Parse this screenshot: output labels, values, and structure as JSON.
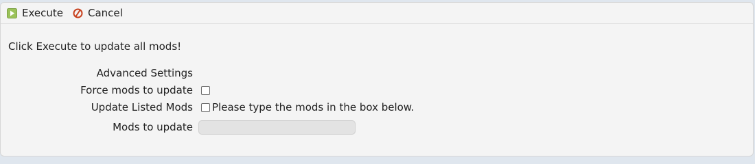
{
  "toolbar": {
    "execute_label": "Execute",
    "cancel_label": "Cancel"
  },
  "form": {
    "intro_text": "Click Execute to update all mods!",
    "advanced_heading": "Advanced Settings",
    "force_label": "Force mods to update",
    "force_checked": false,
    "listed_label": "Update Listed Mods",
    "listed_checked": false,
    "listed_hint": "Please type the mods in the box below.",
    "mods_label": "Mods to update",
    "mods_value": "",
    "mods_placeholder": ""
  },
  "colors": {
    "execute_icon": "#9bc25a",
    "cancel_icon": "#c8411e"
  }
}
